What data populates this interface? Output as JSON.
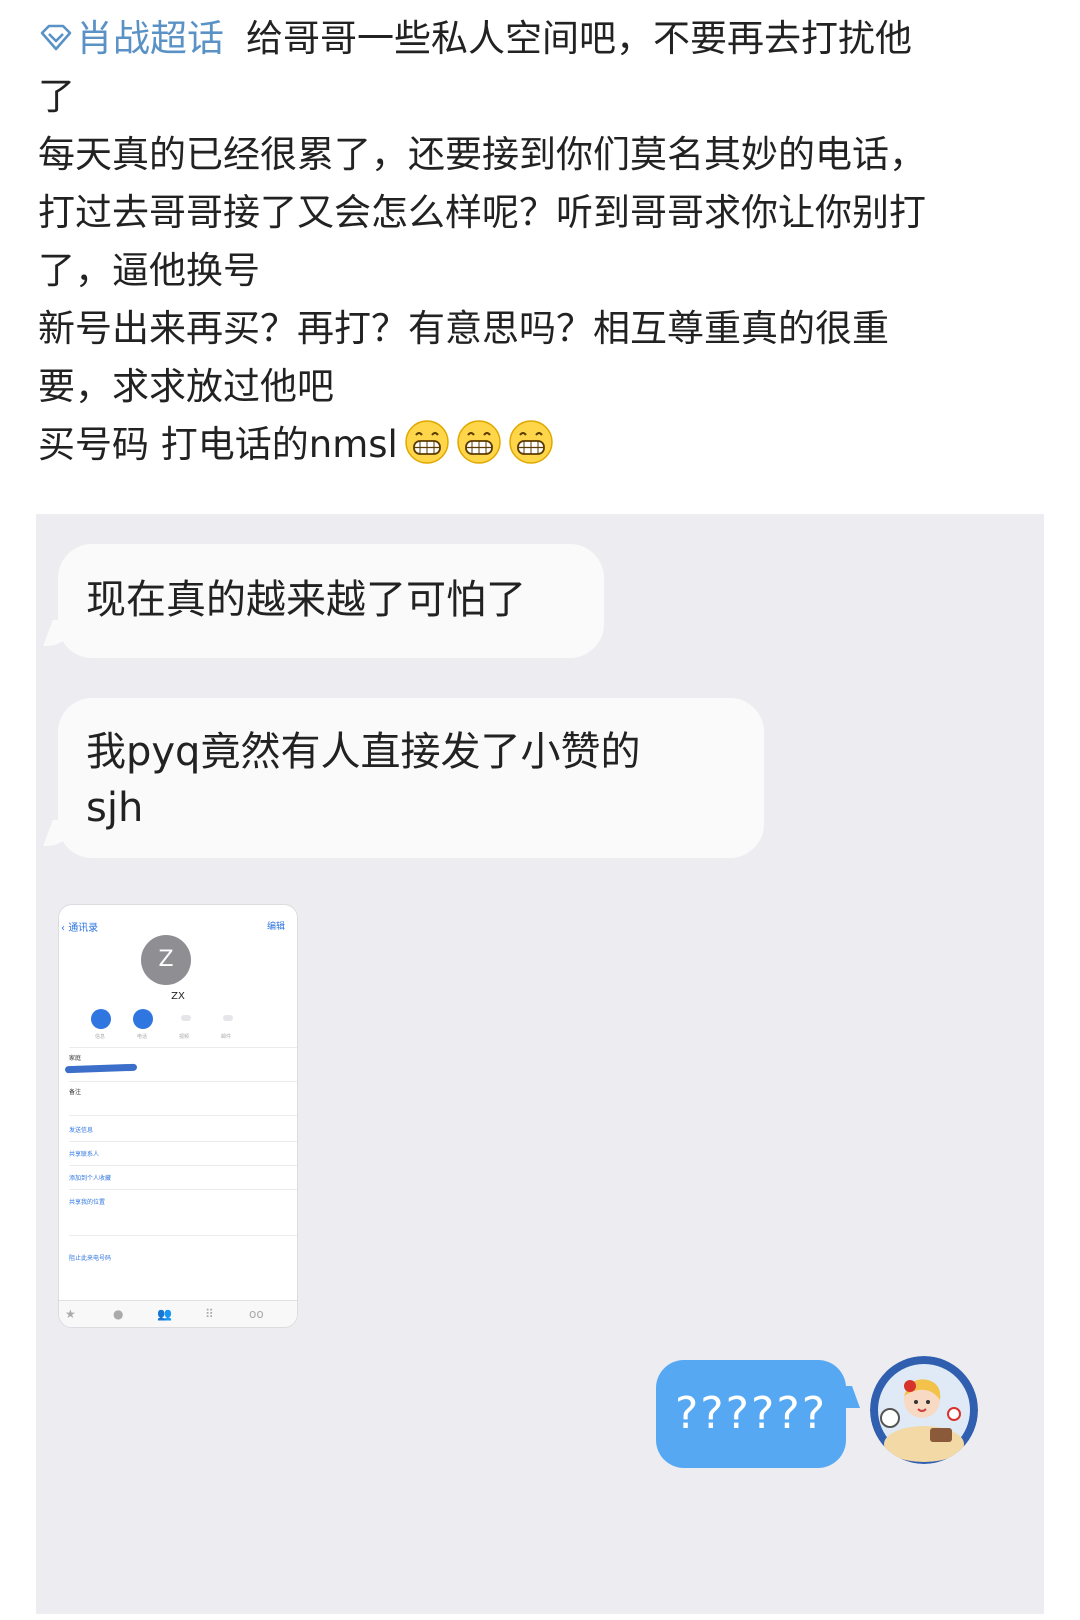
{
  "post": {
    "topic_label": "肖战超话",
    "lines": [
      "给哥哥一些私人空间吧，不要再去打扰他",
      "了",
      "每天真的已经很累了，还要接到你们莫名其妙的电话，",
      "打过去哥哥接了又会怎么样呢？听到哥哥求你让你别打",
      "了，逼他换号",
      "新号出来再买？再打？有意思吗？相互尊重真的很重",
      "要，求求放过他吧",
      "买号码 打电话的nmsl"
    ],
    "emojis": [
      "grin-emoji",
      "grin-emoji",
      "grin-emoji"
    ],
    "topic_color": "#5a92c6"
  },
  "chat": {
    "background": "#ededf1",
    "incoming": [
      {
        "line1": "现在真的越来越了可怕了",
        "line2": ""
      },
      {
        "line1": "我pyq竟然有人直接发了小赞的",
        "line2": "sjh"
      }
    ],
    "phone_screenshot": {
      "back_label": "通讯录",
      "edit_label": "编辑",
      "avatar_letter": "Z",
      "contact_name": "ZX",
      "action_labels": [
        "信息",
        "电话",
        "视频",
        "邮件"
      ],
      "rows": [
        "家庭",
        "备注",
        "发送信息",
        "共享联系人",
        "添加到个人收藏",
        "共享我的位置",
        "阻止此来电号码"
      ]
    },
    "outgoing": {
      "text": "??????",
      "color": "#56a8f3"
    }
  }
}
